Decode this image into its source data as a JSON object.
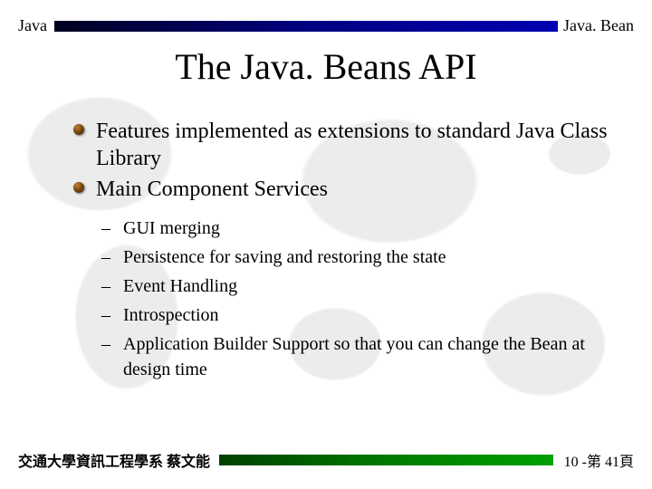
{
  "header": {
    "left": "Java",
    "right": "Java. Bean"
  },
  "title": "The Java. Beans API",
  "bullets": [
    {
      "text": "Features implemented as extensions to standard Java Class Library"
    },
    {
      "text": "Main Component Services"
    }
  ],
  "subbullets": [
    {
      "text": "GUI merging"
    },
    {
      "text": "Persistence for saving and restoring the state"
    },
    {
      "text": "Event Handling"
    },
    {
      "text": "Introspection"
    },
    {
      "text": "Application Builder Support so that you can change the Bean at design time"
    }
  ],
  "footer": {
    "left": "交通大學資訊工程學系 蔡文能",
    "right": "10 -第 41頁"
  },
  "glyphs": {
    "dash": "–"
  }
}
